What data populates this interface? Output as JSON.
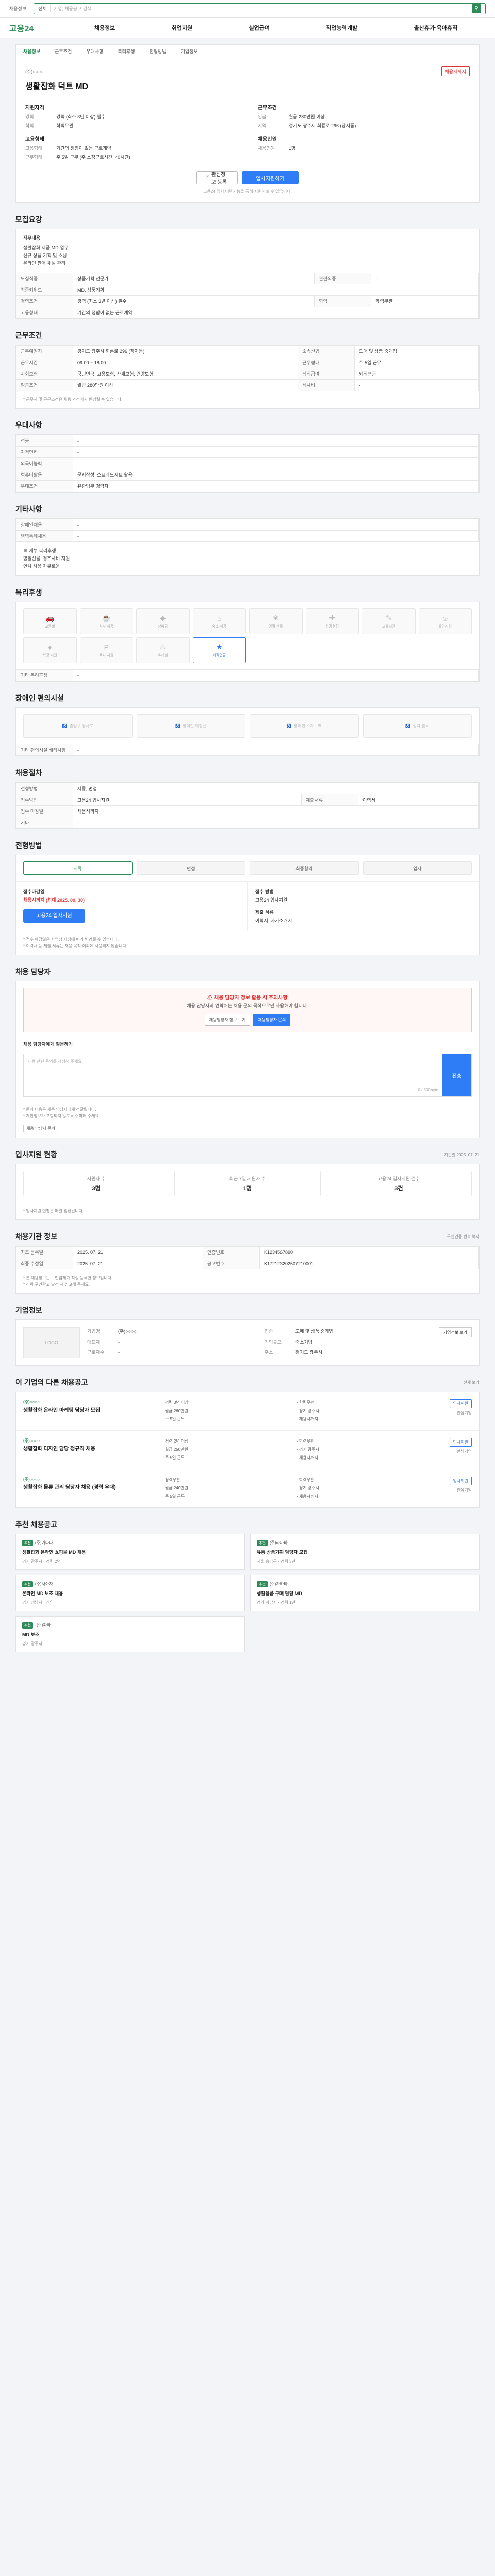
{
  "topbar": {
    "left_text": "채용정보",
    "search_select": "전체",
    "search_placeholder": "기업, 채용공고 검색"
  },
  "nav": {
    "logo": "고용24",
    "menu": [
      "채용정보",
      "취업지원",
      "실업급여",
      "직업능력개발",
      "출산휴가·육아휴직"
    ]
  },
  "subtabs": [
    "채용정보",
    "근무조건",
    "우대사항",
    "복리후생",
    "전형방법",
    "기업정보"
  ],
  "job": {
    "company": "(주)○○○○",
    "badge": "채용시까지",
    "title": "생활잡화 덕트 MD",
    "col1_head": "지원자격",
    "col1": [
      {
        "k": "경력",
        "v": "경력 (최소 3년 이상) 필수"
      },
      {
        "k": "학력",
        "v": "학력무관"
      }
    ],
    "col2_head": "근무조건",
    "col2": [
      {
        "k": "임금",
        "v": "월급 280만원 이상"
      },
      {
        "k": "지역",
        "v": "경기도 광주시 회룡로 296 (장지동)"
      }
    ],
    "col3_head": "고용형태",
    "col3": [
      {
        "k": "고용형태",
        "v": "기간의 정함이 없는 근로계약"
      },
      {
        "k": "근무형태",
        "v": "주 5일 근무 (주 소정근로시간: 40시간)"
      }
    ],
    "col4_head": "채용인원",
    "col4": [
      {
        "k": "채용인원",
        "v": "1명"
      }
    ],
    "save_btn": "관심정보 등록",
    "apply_btn": "입사지원하기",
    "note": "고용24 입사지원 기능을 통해 지원하실 수 있습니다."
  },
  "recruit": {
    "title": "모집요강",
    "desc_title": "직무내용",
    "desc": [
      "생활잡화 제품 MD 업무",
      "신규 상품 기획 및 소싱",
      "온라인 판매 채널 관리"
    ],
    "rows": [
      {
        "k": "모집직종",
        "v": "상품기획 전문가",
        "k2": "관련직종",
        "v2": "-"
      },
      {
        "k": "직종키워드",
        "v": "MD, 상품기획",
        "k2": "",
        "v2": ""
      },
      {
        "k": "경력조건",
        "v": "경력 (최소 3년 이상) 필수",
        "k2": "학력",
        "v2": "학력무관"
      },
      {
        "k": "고용형태",
        "v": "기간의 정함이 없는 근로계약",
        "k2": "",
        "v2": ""
      }
    ]
  },
  "conditions": {
    "title": "근무조건",
    "rows": [
      {
        "k": "근무예정지",
        "v": "경기도 광주시 회룡로 296 (장지동)"
      },
      {
        "k": "소속산업",
        "v": "도매 및 상품 중개업"
      },
      {
        "k": "근무시간",
        "v": "09:00 ~ 18:00"
      },
      {
        "k": "근무형태",
        "v": "주 5일 근무"
      },
      {
        "k": "사회보험",
        "v": "국민연금, 고용보험, 산재보험, 건강보험"
      },
      {
        "k": "퇴직급여",
        "v": "퇴직연금"
      },
      {
        "k": "임금조건",
        "v": "월급 280만원 이상"
      },
      {
        "k": "식사비",
        "v": "-"
      }
    ],
    "footnote": "* 근무지 및 근무조건은 채용 과정에서 변경될 수 있습니다."
  },
  "prefer": {
    "title": "우대사항",
    "rows": [
      {
        "k": "전공",
        "v": "-"
      },
      {
        "k": "자격면허",
        "v": "-"
      },
      {
        "k": "외국어능력",
        "v": "-"
      },
      {
        "k": "컴퓨터활용",
        "v": "문서작성, 스프레드시트 활용"
      },
      {
        "k": "우대조건",
        "v": "유관업무 경력자"
      }
    ]
  },
  "other": {
    "title": "기타사항",
    "rows": [
      {
        "k": "장애인채용",
        "v": "-"
      },
      {
        "k": "병역특례채용",
        "v": "-"
      }
    ],
    "desc": [
      "※ 세부 복리후생",
      "명절선물, 경조사비 지원",
      "연차 사용 자유로움"
    ]
  },
  "welfare": {
    "title": "복리후생",
    "tiles": [
      {
        "icon": "car-icon",
        "label": "교통비"
      },
      {
        "icon": "meal-icon",
        "label": "식사 제공"
      },
      {
        "icon": "bonus-icon",
        "label": "상여금"
      },
      {
        "icon": "house-icon",
        "label": "숙소 제공"
      },
      {
        "icon": "gift-icon",
        "label": "명절 선물"
      },
      {
        "icon": "health-icon",
        "label": "건강검진"
      },
      {
        "icon": "edu-icon",
        "label": "교육지원"
      },
      {
        "icon": "child-icon",
        "label": "육아지원"
      },
      {
        "icon": "dress-icon",
        "label": "복장 지원"
      },
      {
        "icon": "parking-icon",
        "label": "주차 지원"
      },
      {
        "icon": "rest-icon",
        "label": "휴게실"
      },
      {
        "icon": "retire-icon",
        "label": "퇴직연금"
      }
    ],
    "active_index": 11,
    "other_title": "기타 복리후생",
    "other_value": "-"
  },
  "disabled": {
    "title": "장애인 편의시설",
    "tiles": [
      "출입구 경사로",
      "장애인 화장실",
      "장애인 주차구역",
      "점자 블록"
    ],
    "other_title": "기타 편의시설 배려사항",
    "other_value": "-"
  },
  "process": {
    "title": "채용절차",
    "rows": [
      {
        "k": "전형방법",
        "v": "서류, 면접",
        "k2": "",
        "v2": ""
      },
      {
        "k": "접수방법",
        "v": "고용24 입사지원",
        "k2": "제출서류",
        "v2": "이력서"
      },
      {
        "k": "접수 마감일",
        "v": "채용시까지",
        "k2": "",
        "v2": ""
      },
      {
        "k": "기타",
        "v": "-",
        "k2": "",
        "v2": ""
      }
    ]
  },
  "steps": {
    "title": "전형방법",
    "items": [
      "서류",
      "면접",
      "최종합격",
      "입사"
    ]
  },
  "howto": {
    "left_title": "접수마감일",
    "left_value": "채용시까지 (최대 2025. 09. 30)",
    "apply_btn": "고용24 입사지원",
    "right_title": "접수 방법",
    "right_value": "고용24 입사지원",
    "right_title2": "제출 서류",
    "right_value2": "이력서, 자기소개서",
    "notes": [
      "* 접수 마감일은 사업장 사정에 따라 변경될 수 있습니다.",
      "* 이력서 등 제출 서류는 채용 목적 이외에 사용되지 않습니다."
    ]
  },
  "contact": {
    "title": "채용 담당자",
    "warn_head": "채용 담당자 정보 활용 시 주의사항",
    "warn_body": "채용 담당자의 연락처는 채용 문의 목적으로만 사용해야 합니다.",
    "btn_info": "채용담당자 정보 보기",
    "btn_ask": "채용담당자 문의",
    "q_label": "채용 담당자에게 질문하기",
    "q_placeholder": "채용 관련 문의를 작성해 주세요.",
    "q_counter": "0 / 500byte",
    "q_send": "전송",
    "q_notes": [
      "* 문의 내용은 채용 담당자에게 전달됩니다.",
      "* 개인정보가 포함되지 않도록 주의해 주세요."
    ],
    "q_chip": "채용 담당자 문의"
  },
  "stats": {
    "title": "입사지원 현황",
    "right": "기준일 2025. 07. 21",
    "items": [
      {
        "l": "지원자 수",
        "n": "3명"
      },
      {
        "l": "최근 7일 지원자 수",
        "n": "1명"
      },
      {
        "l": "고용24 입사지원 건수",
        "n": "3건"
      }
    ],
    "note": "* 입사지원 현황은 매일 갱신됩니다."
  },
  "meta": {
    "title": "채용기관 정보",
    "right": "구인인증 번호 복사",
    "rows": [
      {
        "k": "최초 등록일",
        "v": "2025. 07. 21",
        "k2": "인증번호",
        "v2": "K1234567890"
      },
      {
        "k": "최종 수정일",
        "v": "2025. 07. 21",
        "k2": "공고번호",
        "v2": "K172123202507210001"
      }
    ],
    "notes": [
      "* 본 채용정보는 구인업체가 직접 등록한 정보입니다.",
      "* 허위 구인광고 발견 시 신고해 주세요."
    ]
  },
  "company": {
    "title": "기업정보",
    "logo": "LOGO",
    "rows": [
      {
        "k": "기업명",
        "v": "(주)○○○○"
      },
      {
        "k": "업종",
        "v": "도매 및 상품 중개업"
      },
      {
        "k": "대표자",
        "v": "-"
      },
      {
        "k": "기업규모",
        "v": "중소기업"
      },
      {
        "k": "근로자수",
        "v": "-"
      },
      {
        "k": "주소",
        "v": "경기도 광주시"
      }
    ],
    "btn": "기업정보 보기"
  },
  "similar": {
    "title": "이 기업의 다른 채용공고",
    "right": "전체 보기",
    "jobs": [
      {
        "co": "(주)○○○○",
        "t": "생활잡화 온라인 마케팅 담당자 모집",
        "meta": [
          "경력 3년 이상",
          "학력무관",
          "월급 260만원",
          "경기 광주시",
          "주 5일 근무",
          "채용시까지"
        ],
        "ap": "입사지원",
        "sv": "관심기업"
      },
      {
        "co": "(주)○○○○",
        "t": "생활잡화 디자인 담당 정규직 채용",
        "meta": [
          "경력 2년 이상",
          "학력무관",
          "월급 250만원",
          "경기 광주시",
          "주 5일 근무",
          "채용시까지"
        ],
        "ap": "입사지원",
        "sv": "관심기업"
      },
      {
        "co": "(주)○○○○",
        "t": "생활잡화 물류 관리 담당자 채용 (경력 우대)",
        "meta": [
          "경력무관",
          "학력무관",
          "월급 240만원",
          "경기 광주시",
          "주 5일 근무",
          "채용시까지"
        ],
        "ap": "입사지원",
        "sv": "관심기업"
      }
    ]
  },
  "recommend": {
    "title": "추천 채용공고",
    "cards": [
      {
        "tg": "추천",
        "co": "(주)가나다",
        "t": "생활잡화 온라인 쇼핑몰 MD 채용",
        "s": "경기 광주시 · 경력 2년"
      },
      {
        "tg": "추천",
        "co": "(주)라마바",
        "t": "유통 상품기획 담당자 모집",
        "s": "서울 송파구 · 경력 3년"
      },
      {
        "tg": "추천",
        "co": "(주)사아자",
        "t": "온라인 MD 보조 채용",
        "s": "경기 성남시 · 신입"
      },
      {
        "tg": "추천",
        "co": "(주)차카타",
        "t": "생활용품 구매 담당 MD",
        "s": "경기 하남시 · 경력 1년"
      }
    ]
  },
  "footer_card": {
    "tg": "추천",
    "co": "(주)파하",
    "t": "MD 보조",
    "s": "경기 광주시"
  }
}
